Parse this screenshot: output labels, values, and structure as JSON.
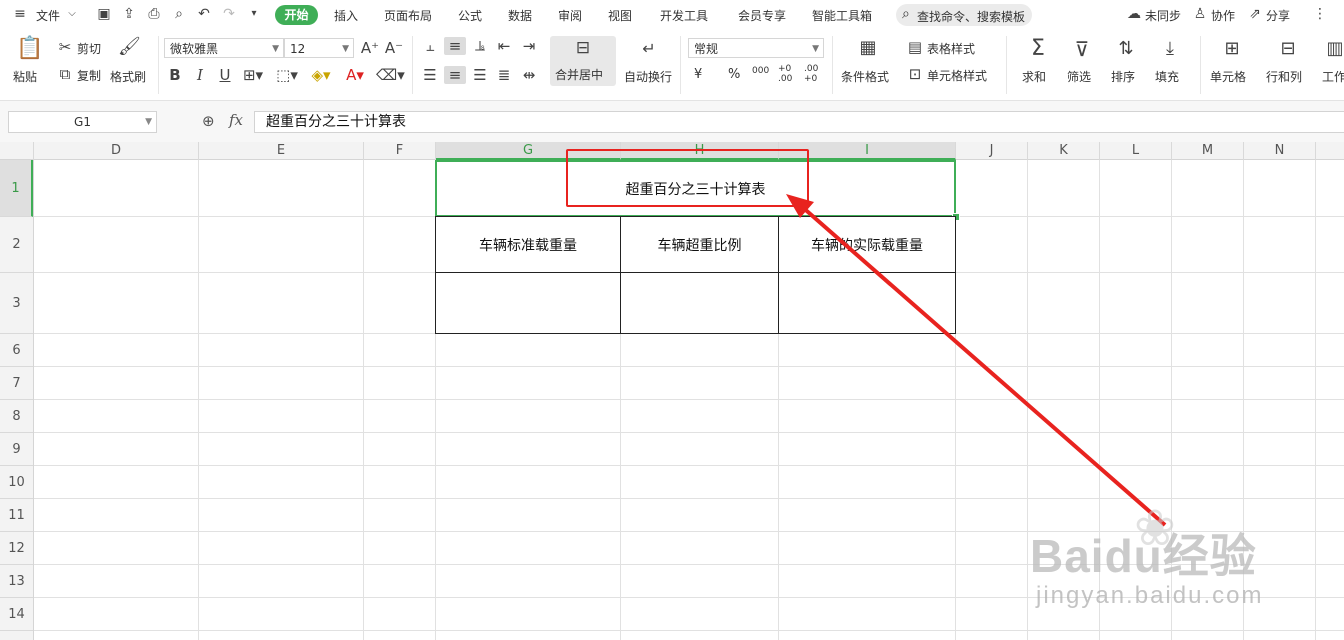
{
  "menubar": {
    "file_label": "文件",
    "tabs": [
      "开始",
      "插入",
      "页面布局",
      "公式",
      "数据",
      "审阅",
      "视图",
      "开发工具",
      "会员专享",
      "智能工具箱"
    ],
    "search_label": "查找命令、搜索模板",
    "sync_label": "未同步",
    "collab_label": "协作",
    "share_label": "分享"
  },
  "ribbon": {
    "paste": "粘贴",
    "cut": "剪切",
    "copy": "复制",
    "format_painter": "格式刷",
    "font_name": "微软雅黑",
    "font_size": "12",
    "merge_center": "合并居中",
    "wrap_text": "自动换行",
    "number_format": "常规",
    "currency_symbol": "¥",
    "percent_symbol": "%",
    "thousands_symbol": "000",
    "inc_decimal": "+0 .00",
    "dec_decimal": ".00 +0",
    "conditional_format": "条件格式",
    "table_style": "表格样式",
    "cell_style": "单元格样式",
    "sum": "求和",
    "filter": "筛选",
    "sort": "排序",
    "fill": "填充",
    "cell": "单元格",
    "rows_cols": "行和列",
    "worksheet": "工作"
  },
  "formula_bar": {
    "name_box": "G1",
    "fx_label": "fx",
    "formula": "超重百分之三十计算表"
  },
  "columns": [
    "D",
    "E",
    "F",
    "G",
    "H",
    "I",
    "J",
    "K",
    "L",
    "M",
    "N"
  ],
  "rows": [
    "1",
    "2",
    "3",
    "6",
    "7",
    "8",
    "9",
    "10",
    "11",
    "12",
    "13",
    "14"
  ],
  "table": {
    "title": "超重百分之三十计算表",
    "headers": [
      "车辆标准载重量",
      "车辆超重比例",
      "车辆的实际载重量"
    ]
  },
  "watermark": {
    "brand": "Baidu经验",
    "url": "jingyan.baidu.com"
  },
  "colors": {
    "accent_green": "#3fae57",
    "annotation_red": "#e8231f"
  }
}
